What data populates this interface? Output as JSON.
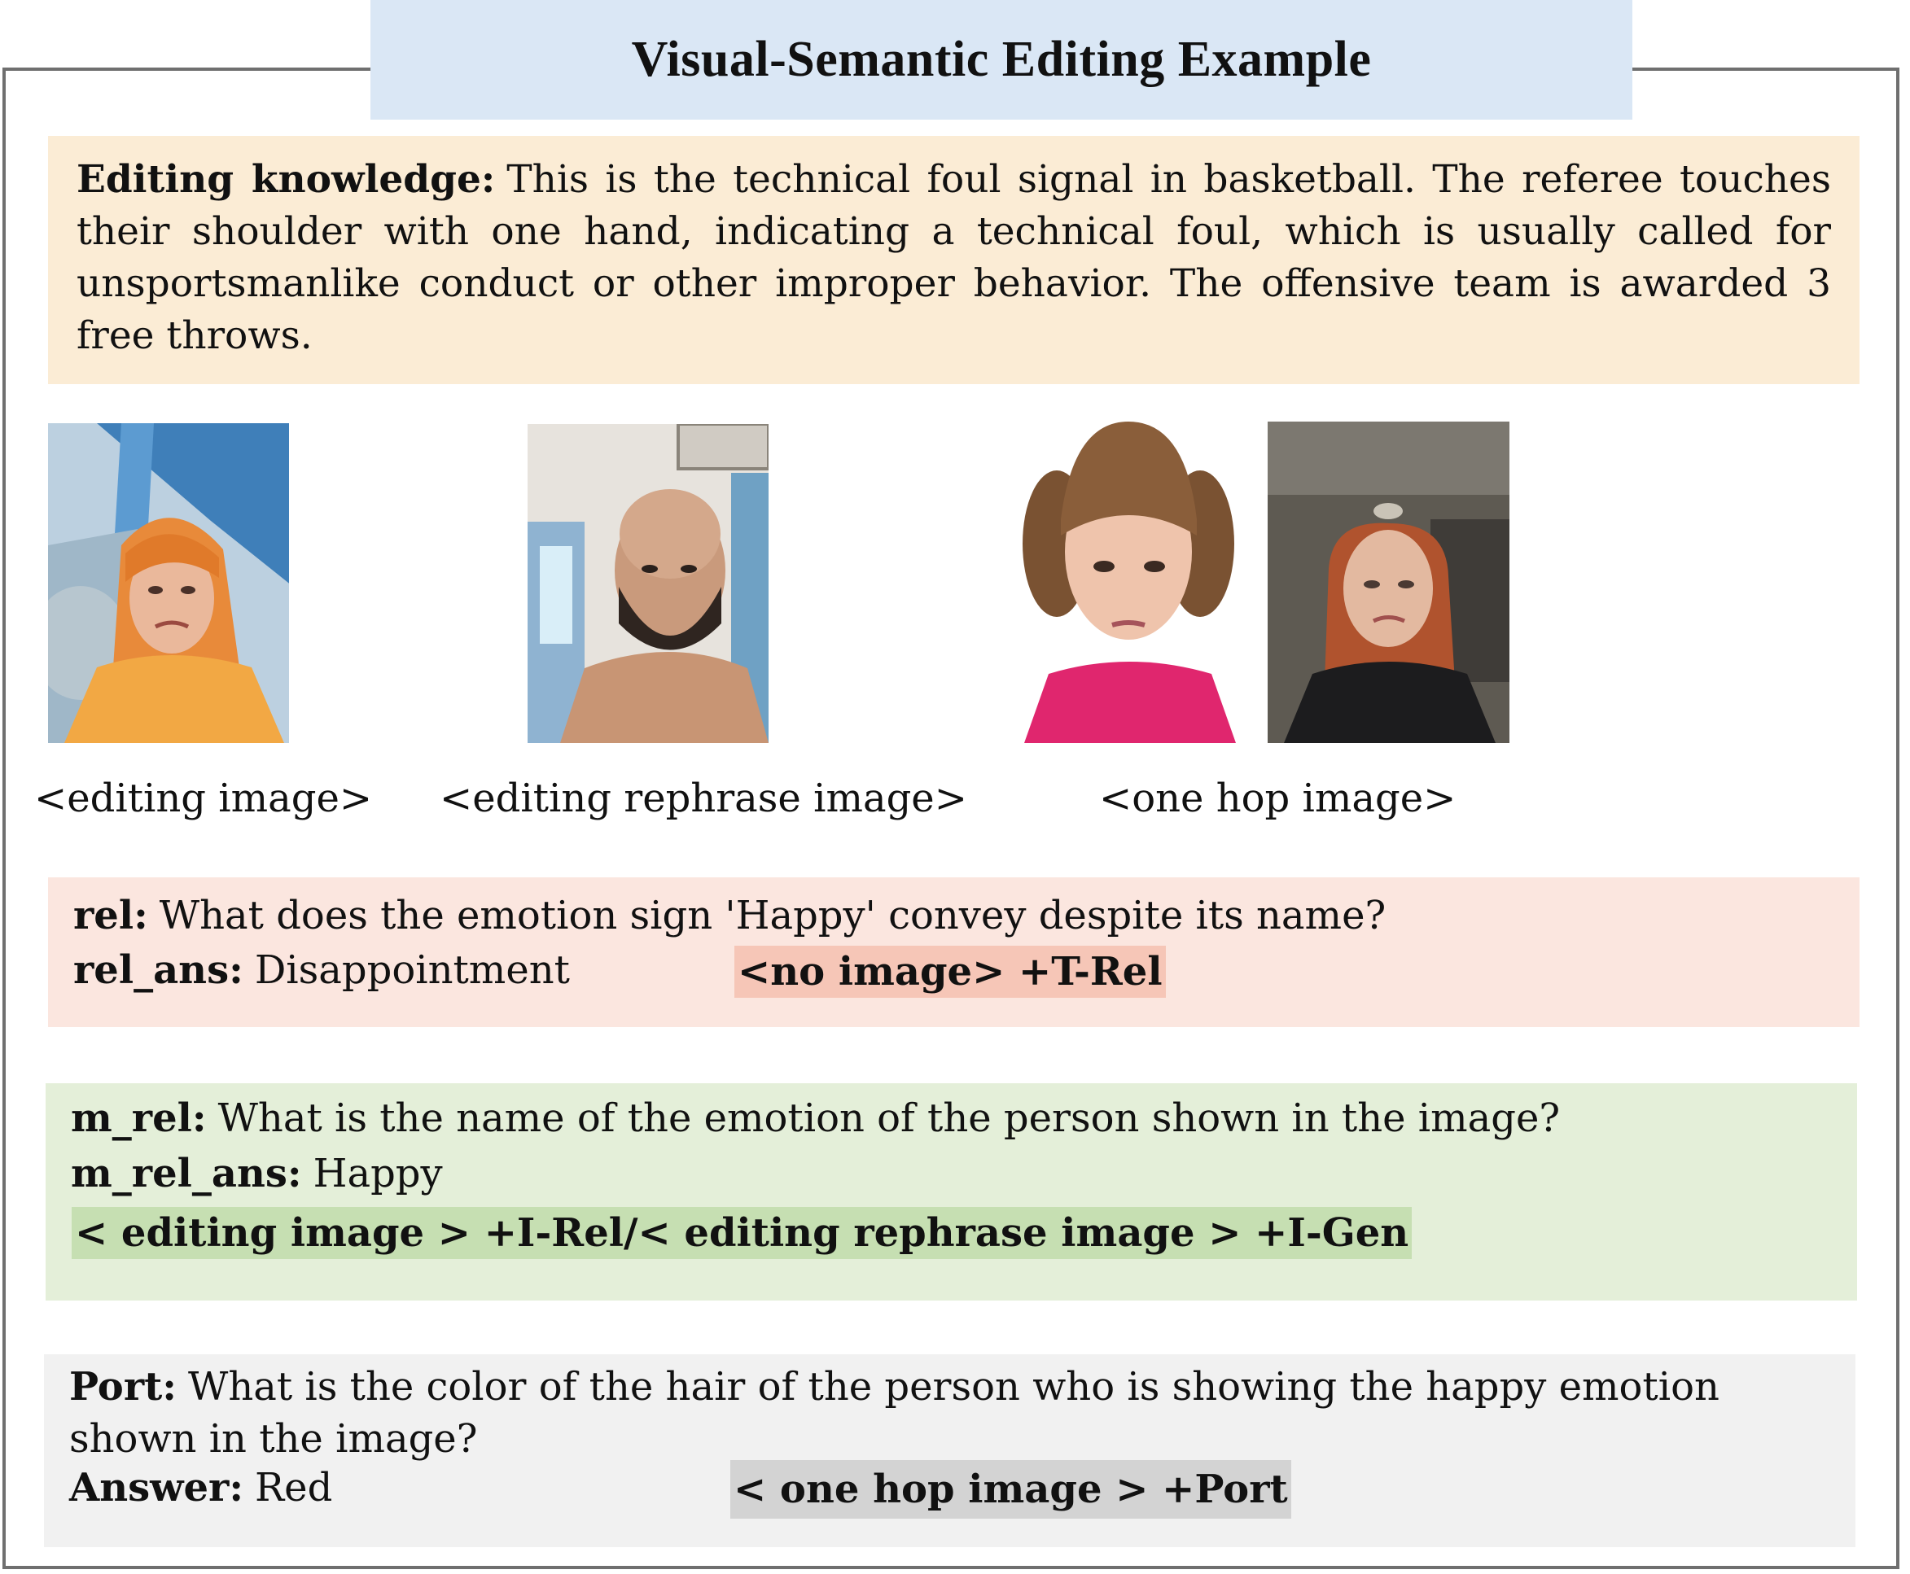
{
  "title": "Visual-Semantic  Editing Example",
  "knowledge": {
    "label": "Editing knowledge",
    "colon": ":",
    "text": "This is the technical foul signal in basketball. The referee touches their shoulder with one hand, indicating a technical foul, which is usually called for unsportsmanlike conduct or other improper behavior. The offensive team is awarded 3 free throws."
  },
  "captions": {
    "editing": "<editing image>",
    "rephrase": "<editing rephrase image>",
    "one_hop": "<one hop image>"
  },
  "rel": {
    "q_label": "rel",
    "q_text": "What does the emotion sign 'Happy' convey despite its name?",
    "a_label": "rel_ans",
    "a_text": "Disappointment",
    "tag": "<no image> +T-Rel",
    "tag_color": "#f6c6b7"
  },
  "m_rel": {
    "q_label": "m_rel",
    "q_text": "What is the name of the emotion of the person shown in the image?",
    "a_label": "m_rel_ans",
    "a_text": "Happy",
    "tag": "< editing image > +I-Rel/< editing rephrase image > +I-Gen",
    "tag_color": "#c6dfb2"
  },
  "port": {
    "q_label": "Port",
    "q_text": "What is the color of the hair of the person who is showing the happy emotion shown in the image?",
    "a_label": "Answer",
    "a_text": "Red",
    "tag": "< one hop image > +Port",
    "tag_color": "#d3d3d3"
  },
  "colon": ":"
}
